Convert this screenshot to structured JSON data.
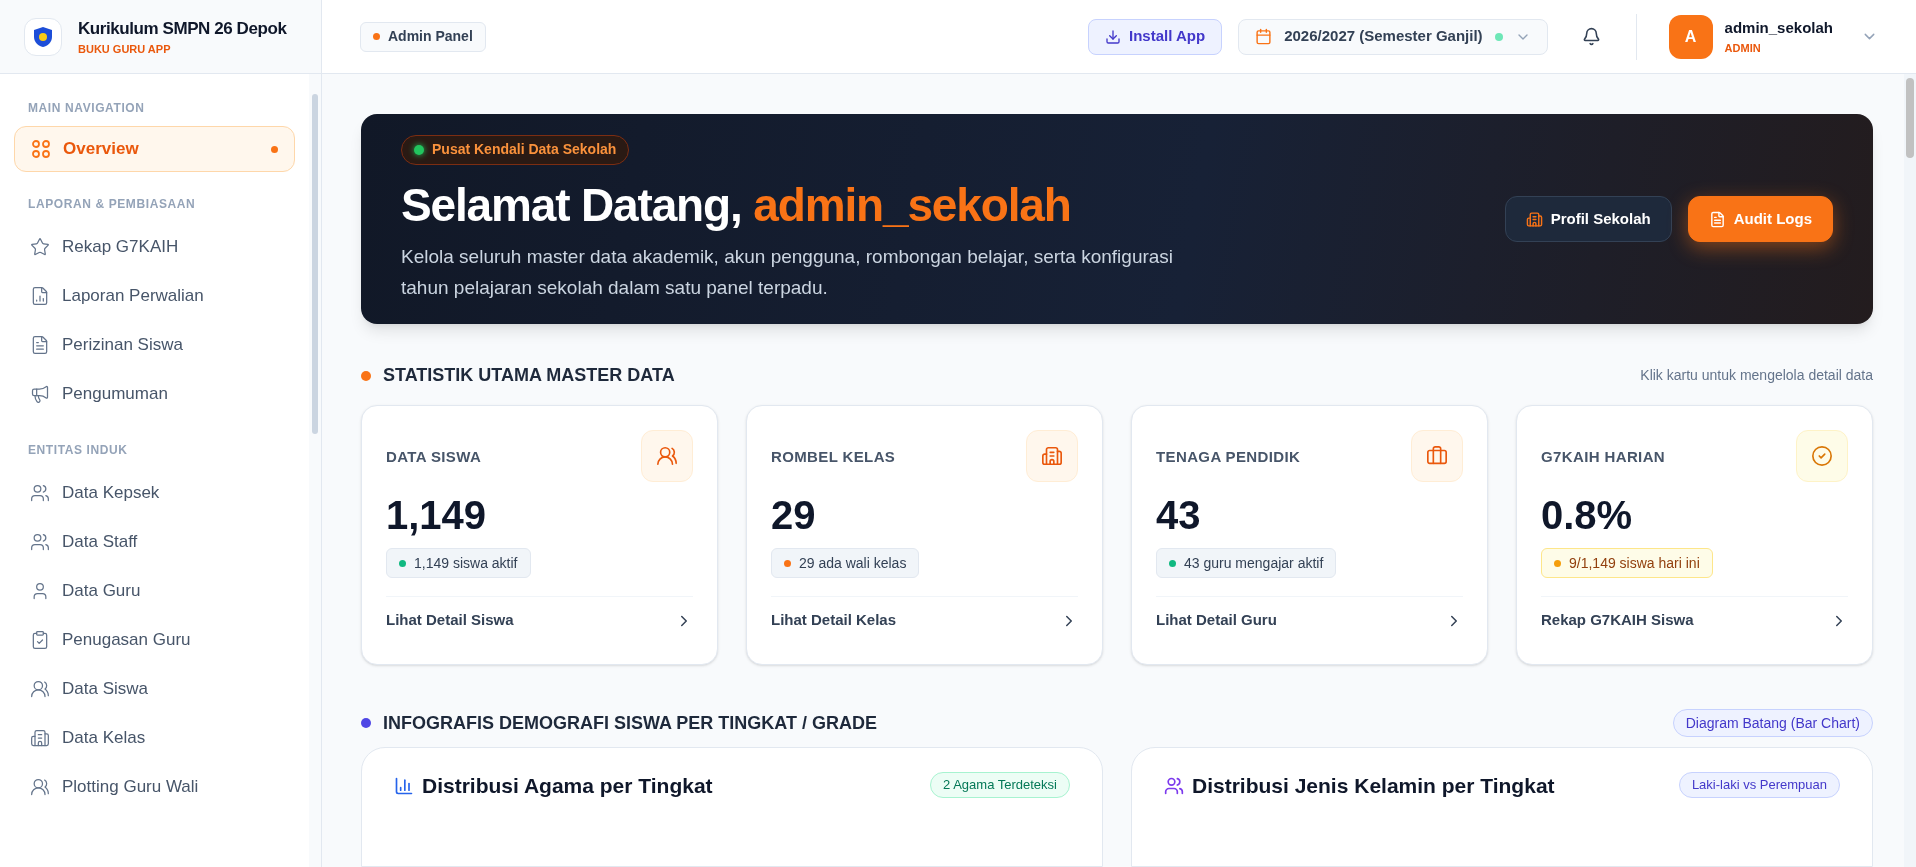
{
  "brand": {
    "title": "Kurikulum SMPN 26 Depok",
    "subtitle": "BUKU GURU APP"
  },
  "sidebar": {
    "sections": [
      {
        "heading": "MAIN NAVIGATION",
        "items": [
          {
            "label": "Overview",
            "selected": true
          }
        ]
      },
      {
        "heading": "LAPORAN & PEMBIASAAN",
        "items": [
          {
            "label": "Rekap G7KAIH",
            "selected": false
          },
          {
            "label": "Laporan Perwalian",
            "selected": false
          },
          {
            "label": "Perizinan Siswa",
            "selected": false
          },
          {
            "label": "Pengumuman",
            "selected": false
          }
        ]
      },
      {
        "heading": "ENTITAS INDUK",
        "items": [
          {
            "label": "Data Kepsek",
            "selected": false
          },
          {
            "label": "Data Staff",
            "selected": false
          },
          {
            "label": "Data Guru",
            "selected": false
          },
          {
            "label": "Penugasan Guru",
            "selected": false
          },
          {
            "label": "Data Siswa",
            "selected": false
          },
          {
            "label": "Data Kelas",
            "selected": false
          },
          {
            "label": "Plotting Guru Wali",
            "selected": false
          }
        ]
      }
    ]
  },
  "topbar": {
    "panel_badge": "Admin Panel",
    "install_button": "Install App",
    "year_selector": "2026/2027 (Semester Ganjil)",
    "user": {
      "avatar": "A",
      "name": "admin_sekolah",
      "role": "ADMIN"
    }
  },
  "hero": {
    "badge": "Pusat Kendali Data Sekolah",
    "greeting": "Selamat Datang,",
    "username": "admin_sekolah",
    "description": "Kelola seluruh master data akademik, akun pengguna, rombongan belajar, serta konfigurasi tahun pelajaran sekolah dalam satu panel terpadu.",
    "buttons": [
      {
        "label": "Profil Sekolah",
        "kind": "secondary"
      },
      {
        "label": "Audit Logs",
        "kind": "primary"
      }
    ]
  },
  "stats_section": {
    "title": "STATISTIK UTAMA MASTER DATA",
    "hint": "Klik kartu untuk mengelola detail data",
    "color": "#f97316"
  },
  "stat_cards": [
    {
      "label": "DATA SISWA",
      "value": "1,149",
      "badge": {
        "text": "1,149 siswa aktif",
        "kind": "neutral",
        "color": "#10b981"
      },
      "link": "Lihat Detail Siswa"
    },
    {
      "label": "ROMBEL KELAS",
      "value": "29",
      "badge": {
        "text": "29 ada wali kelas",
        "kind": "neutral",
        "color": "#f97316"
      },
      "link": "Lihat Detail Kelas"
    },
    {
      "label": "TENAGA PENDIDIK",
      "value": "43",
      "badge": {
        "text": "43 guru mengajar aktif",
        "kind": "neutral",
        "color": "#10b981"
      },
      "link": "Lihat Detail Guru"
    },
    {
      "label": "G7KAIH HARIAN",
      "value": "0.8%",
      "badge": {
        "text": "9/1,149 siswa hari ini",
        "kind": "warning",
        "color": "#f59e0b"
      },
      "link": "Rekap G7KAIH Siswa"
    }
  ],
  "demographics_section": {
    "title": "INFOGRAFIS DEMOGRAFI SISWA PER TINGKAT / GRADE",
    "badge": "Diagram Batang (Bar Chart)",
    "color": "#4f46e5"
  },
  "chart_cards": [
    {
      "title": "Distribusi Agama per Tingkat",
      "badge": {
        "text": "2 Agama Terdeteksi",
        "kind": "success"
      }
    },
    {
      "title": "Distribusi Jenis Kelamin per Tingkat",
      "badge": {
        "text": "Laki-laki vs Perempuan",
        "kind": "info"
      }
    }
  ]
}
